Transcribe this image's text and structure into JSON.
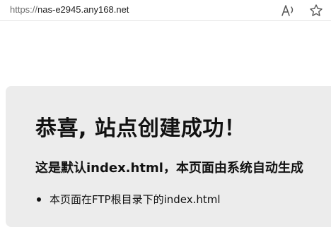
{
  "address_bar": {
    "scheme": "https://",
    "host": "nas-e2945.any168.net"
  },
  "toolbar": {
    "read_aloud_icon": "read-aloud-icon",
    "favorite_icon": "star-icon"
  },
  "content": {
    "title": "恭喜, 站点创建成功！",
    "subtitle": "这是默认index.html，本页面由系统自动生成",
    "list_items": [
      "本页面在FTP根目录下的index.html"
    ]
  }
}
